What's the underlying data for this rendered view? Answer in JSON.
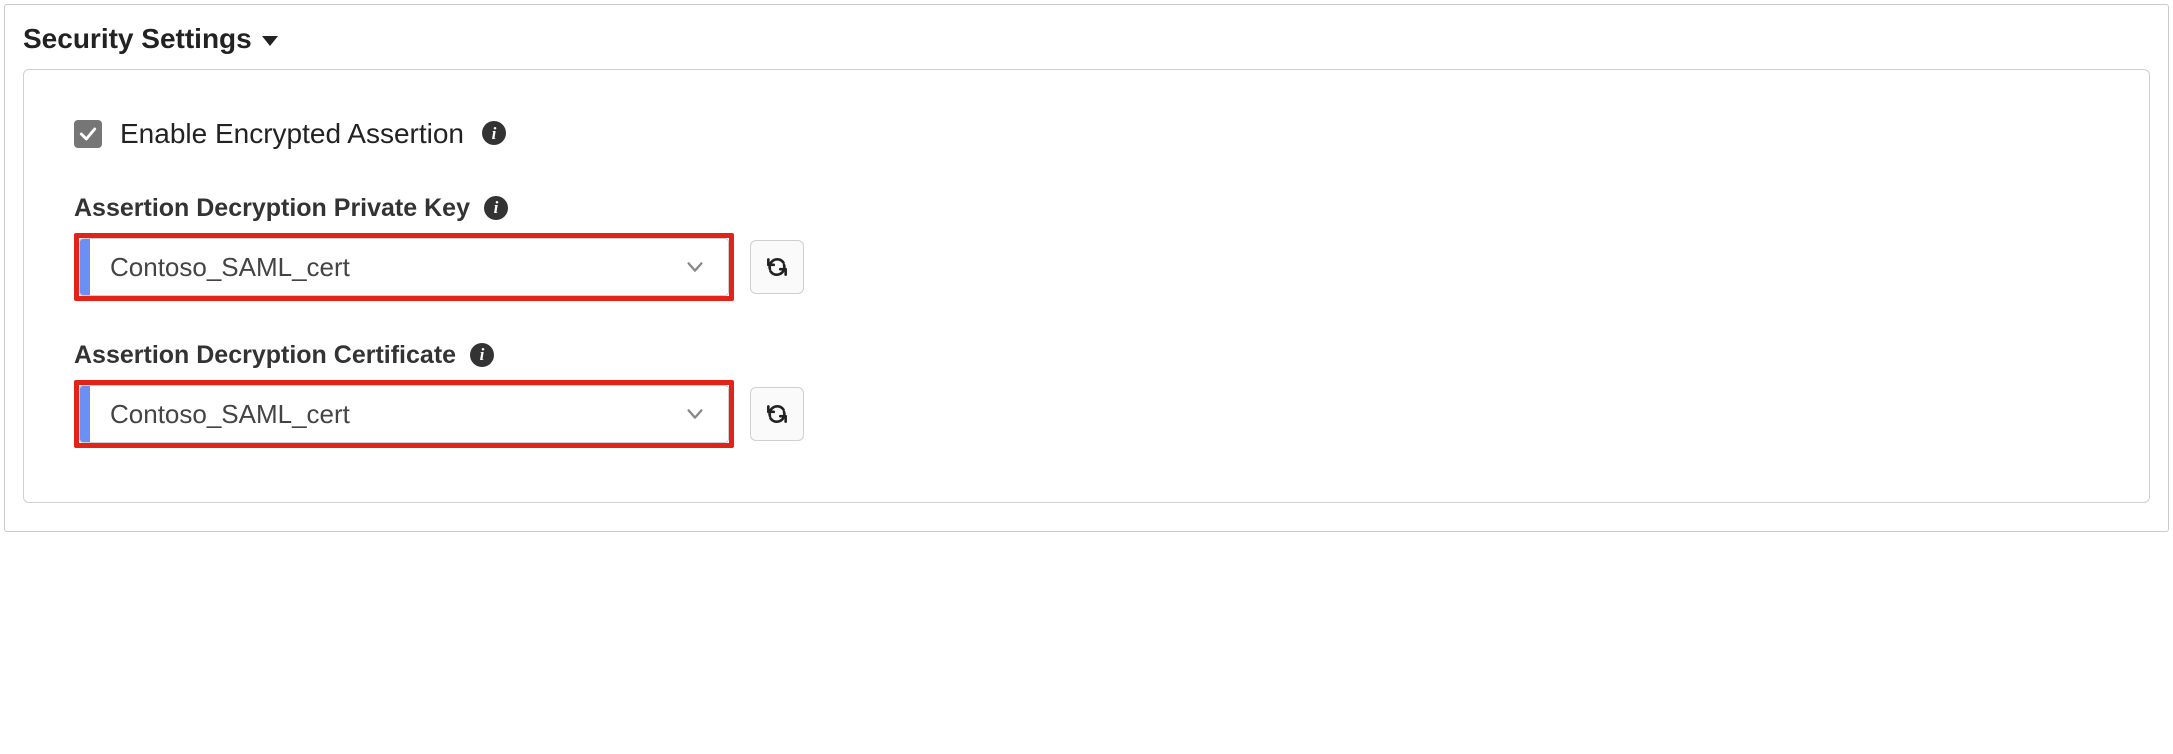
{
  "section": {
    "title": "Security Settings"
  },
  "checkbox": {
    "label": "Enable Encrypted Assertion",
    "checked": true
  },
  "fields": {
    "privateKey": {
      "label": "Assertion Decryption Private Key",
      "value": "Contoso_SAML_cert"
    },
    "certificate": {
      "label": "Assertion Decryption Certificate",
      "value": "Contoso_SAML_cert"
    }
  },
  "icons": {
    "info": "i"
  },
  "colors": {
    "highlight": "#e2231a",
    "accent": "#6b8ff2",
    "checkbox": "#767676"
  }
}
